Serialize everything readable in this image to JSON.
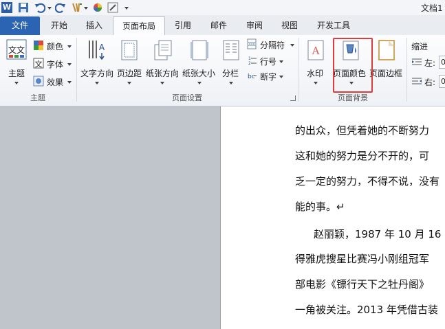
{
  "app": {
    "doc_title": "文档1"
  },
  "tabs": [
    {
      "label": "文件"
    },
    {
      "label": "开始"
    },
    {
      "label": "插入"
    },
    {
      "label": "页面布局"
    },
    {
      "label": "引用"
    },
    {
      "label": "邮件"
    },
    {
      "label": "审阅"
    },
    {
      "label": "视图"
    },
    {
      "label": "开发工具"
    }
  ],
  "ribbon": {
    "theme_group": {
      "label": "主题",
      "theme": "主题",
      "colors": "颜色",
      "fonts": "字体",
      "effects": "效果"
    },
    "page_setup": {
      "label": "页面设置",
      "text_direction": "文字方向",
      "margins": "页边距",
      "orientation": "纸张方向",
      "size": "纸张大小",
      "columns": "分栏",
      "breaks": "分隔符",
      "line_numbers": "行号",
      "hyphenation": "断字"
    },
    "page_background": {
      "label": "页面背景",
      "watermark": "水印",
      "page_color": "页面颜色",
      "page_borders": "页面边框"
    },
    "paragraph": {
      "indent": "缩进",
      "left": "左:",
      "left_value": "0",
      "right": "右:",
      "right_value": "0"
    }
  },
  "document": {
    "lines": [
      "的出众，但凭着她的不断努力",
      "这和她的努力是分不开的，可",
      "乏一定的努力，不得不说，没有",
      "能的事。↵",
      "赵丽颖，1987 年 10 月 16",
      "得雅虎搜星比赛冯小刚组冠军",
      "部电影《镖行天下之牡丹阁》",
      "一角被关注。2013 年凭借古装"
    ]
  },
  "colors": {
    "file_tab": "#2a64b2",
    "highlight": "#e23a3a"
  }
}
